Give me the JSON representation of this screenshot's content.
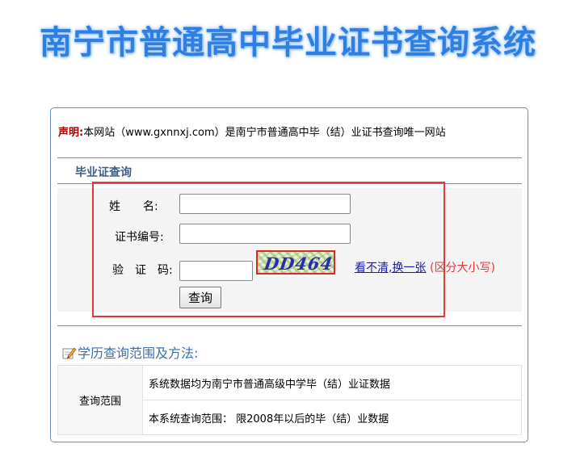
{
  "page": {
    "title": "南宁市普通高中毕业证书查询系统"
  },
  "notice": {
    "label": "声明:",
    "text": "本网站（www.gxnnxj.com）是南宁市普通高中毕（结）业证书查询唯一网站"
  },
  "query_section": {
    "title": "毕业证查询"
  },
  "form": {
    "name_label": "姓　　名:",
    "name_value": "",
    "cert_label": "证书编号:",
    "cert_value": "",
    "captcha_label": "验　证　码:",
    "captcha_value": "",
    "captcha_text": "DD464",
    "refresh_link": "看不清,换一张",
    "case_note": "(区分大小写)",
    "submit_label": "查询"
  },
  "info_section": {
    "title": "学历查询范围及方法:",
    "table": {
      "head": "查询范围",
      "rows": [
        "系统数据均为南宁市普通高级中学毕（结）业证数据",
        "本系统查询范围：  限2008年以后的毕（结）业数据"
      ]
    }
  },
  "colors": {
    "title_blue": "#2f7fe0",
    "border_blue": "#6f8fbf",
    "highlight_red": "#e03838",
    "link_blue": "#1a1aa6"
  },
  "icons": {
    "info_title_icon": "pencil-note-icon"
  }
}
